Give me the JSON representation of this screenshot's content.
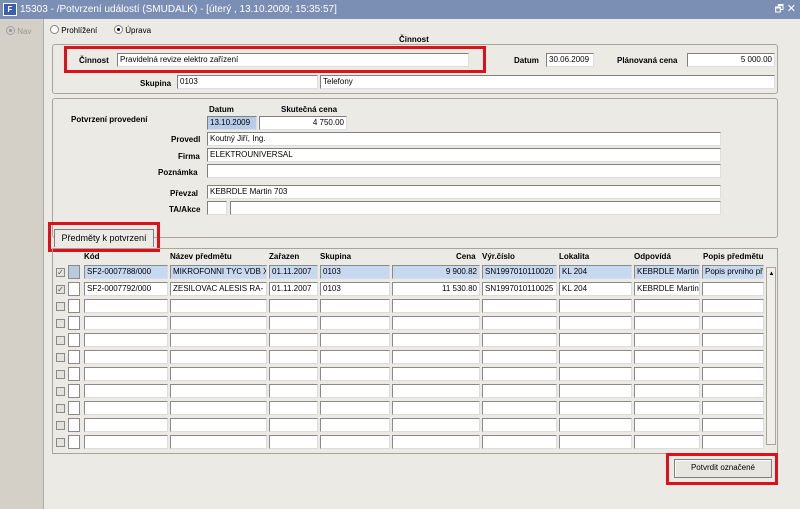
{
  "window": {
    "title": "15303 - /Potvrzení událostí (SMUDALK) - [úterý  , 13.10.2009; 15:35:57]",
    "app_icon": "F"
  },
  "mode": {
    "nav_label": "Nav",
    "browse_label": "Prohlížení",
    "edit_label": "Úprava",
    "selected": "edit"
  },
  "activity": {
    "group_title": "Činnost",
    "cinnost_label": "Činnost",
    "cinnost_value": "Pravidelná revize elektro zařízení",
    "datum_label": "Datum",
    "datum_value": "30.06.2009",
    "planovana_label": "Plánovaná cena",
    "planovana_value": "5 000.00",
    "skupina_label": "Skupina",
    "skupina_code": "0103",
    "skupina_name": "Telefony"
  },
  "confirmation": {
    "section_label": "Potvrzení provedení",
    "datum_label": "Datum",
    "datum_value": "13.10.2009",
    "cena_label": "Skutečná cena",
    "cena_value": "4 750.00",
    "provedl_label": "Provedl",
    "provedl_value": "Koutný Jiří, Ing.",
    "firma_label": "Firma",
    "firma_value": "ELEKTROUNIVERSAL",
    "poznamka_label": "Poznámka",
    "poznamka_value": "",
    "prevzal_label": "Převzal",
    "prevzal_value": "KEBRDLE Martin 703",
    "ta_label": "TA/Akce",
    "ta_value1": "",
    "ta_value2": ""
  },
  "items_tab": {
    "label": "Předměty k potvrzení"
  },
  "table": {
    "columns": [
      "Kód",
      "Název předmětu",
      "Zařazen",
      "Skupina",
      "Cena",
      "Výr.číslo",
      "Lokalita",
      "Odpovídá",
      "Popis předmětu"
    ],
    "rows": [
      {
        "kod": "SF2-0007788/000",
        "nazev": "MIKROFONNI TYC VDB X",
        "zarazen": "01.11.2007",
        "skupina": "0103",
        "cena": "9 900.82",
        "vyr": "SN1997010110020",
        "lokalita": "KL 204",
        "odpovida": "KEBRDLE Martin",
        "popis": "Popis prvniho př"
      },
      {
        "kod": "SF2-0007792/000",
        "nazev": "ZESILOVAC ALESIS RA-",
        "zarazen": "01.11.2007",
        "skupina": "0103",
        "cena": "11 530.80",
        "vyr": "SN1997010110025",
        "lokalita": "KL 204",
        "odpovida": "KEBRDLE Martin",
        "popis": ""
      }
    ]
  },
  "confirm_button": {
    "label": "Potvrdit označené"
  }
}
